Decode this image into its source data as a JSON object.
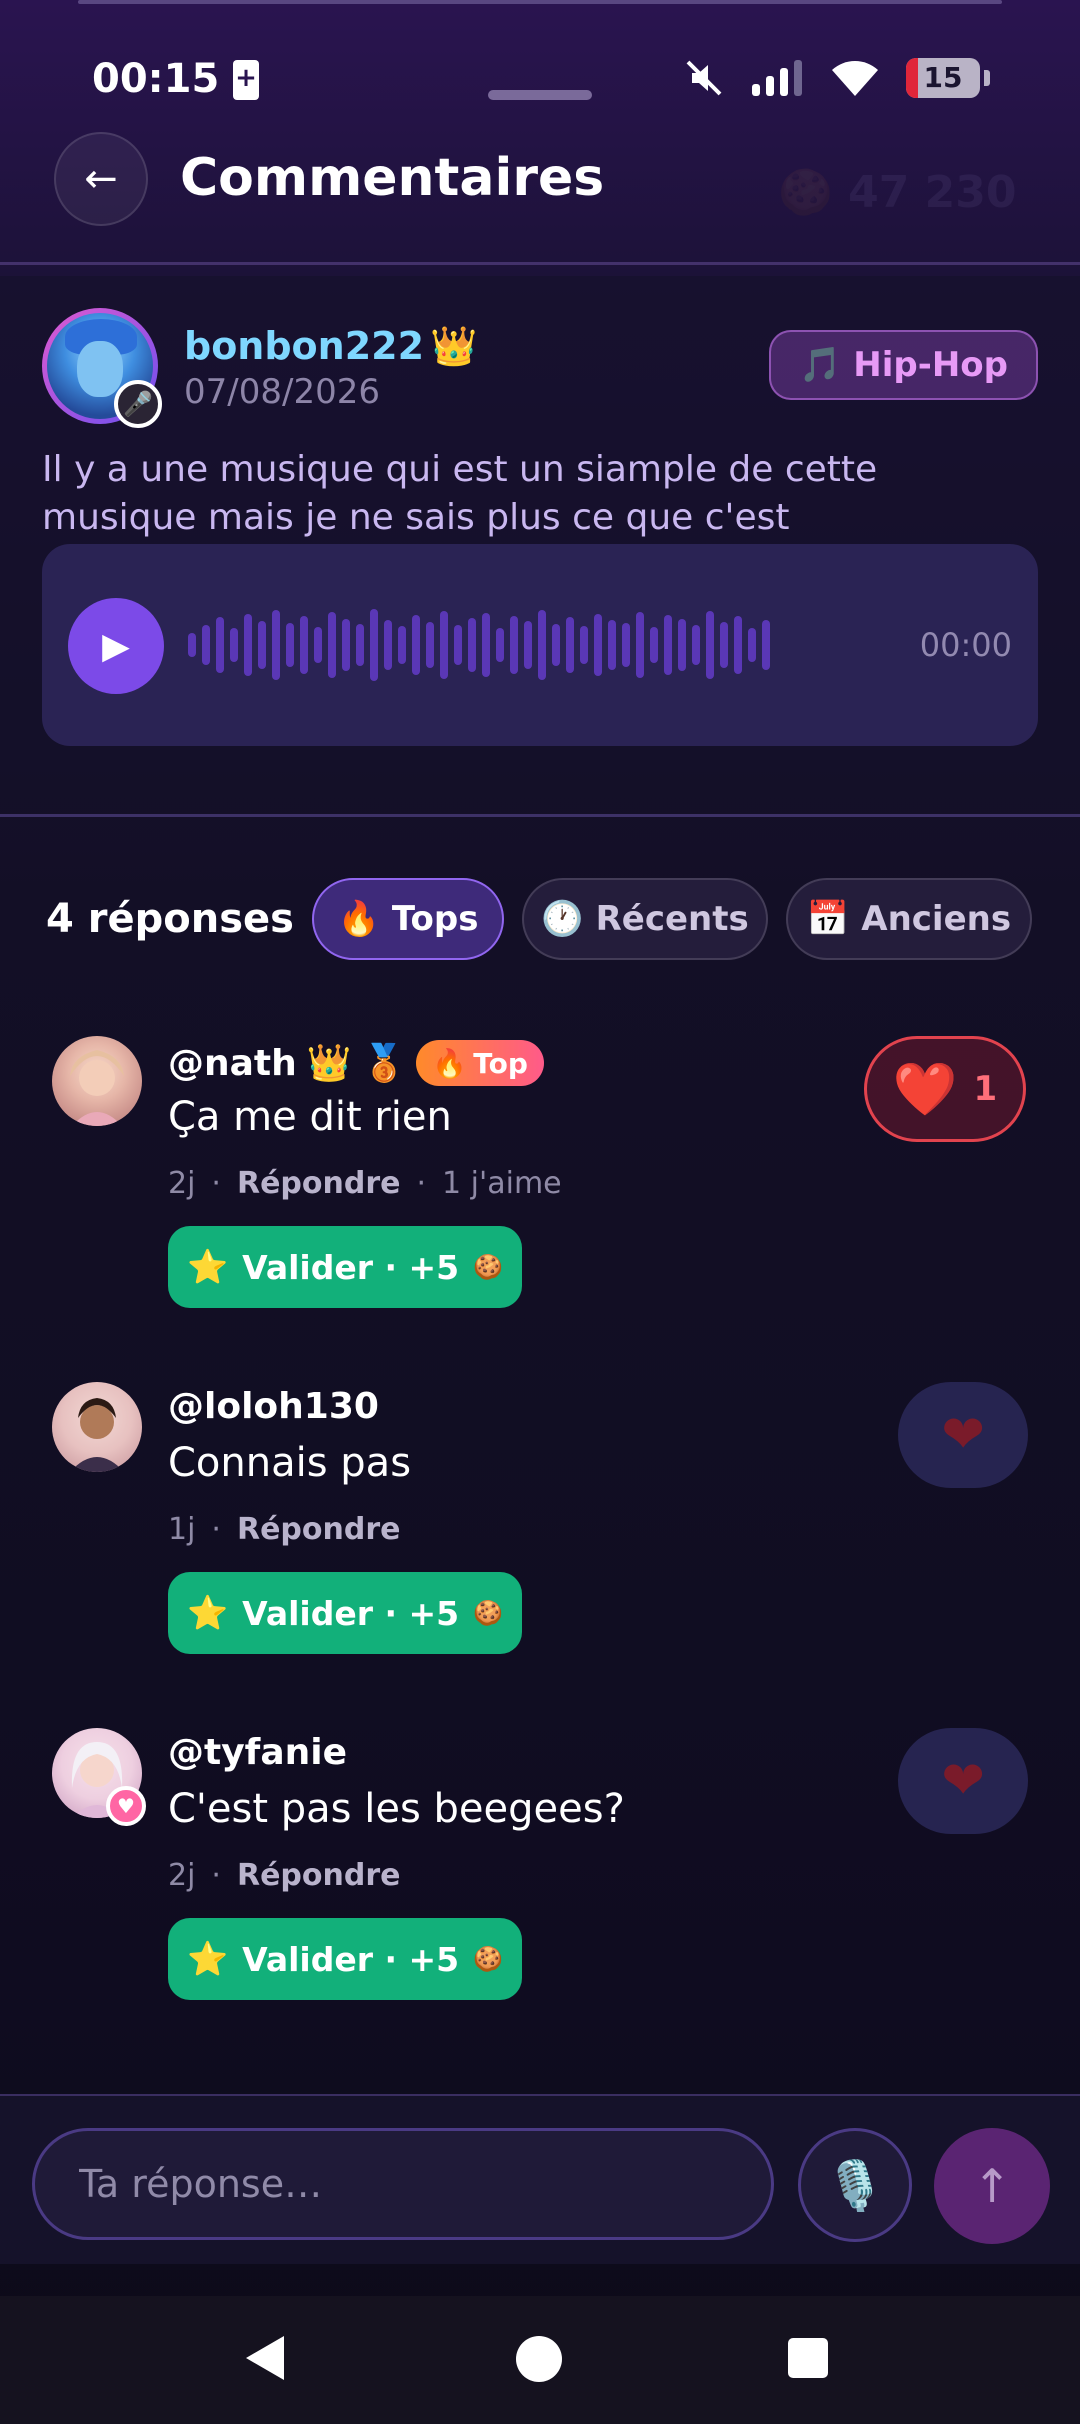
{
  "status_bar": {
    "time": "00:15",
    "battery_level": "15"
  },
  "header": {
    "back_label": "←",
    "title": "Commentaires"
  },
  "post": {
    "username": "bonbon222",
    "crown": "👑",
    "date": "07/08/2026",
    "genre_icon": "🎵",
    "genre": "Hip-Hop",
    "text": "Il y a une musique qui est un siample de cette musique mais je ne sais plus ce que c'est",
    "audio": {
      "play_icon": "▶",
      "duration": "00:00"
    }
  },
  "replies": {
    "count_label": "4 réponses",
    "sort_options": [
      {
        "icon": "🔥",
        "label": "Tops",
        "active": true
      },
      {
        "icon": "🕐",
        "label": "Récents",
        "active": false
      },
      {
        "icon": "📅",
        "label": "Anciens",
        "active": false
      }
    ],
    "items": [
      {
        "handle": "@nath",
        "crown": "👑",
        "medal": "🥉",
        "top_badge": "Top",
        "top_badge_icon": "🔥",
        "text": "Ça me dit rien",
        "age": "2j",
        "reply_label": "Répondre",
        "likes_text": "1 j'aime",
        "validate_label": "Valider · +5",
        "validate_star": "⭐",
        "validate_coin": "🍪",
        "like_heart": "❤️",
        "like_count": "1",
        "liked": true
      },
      {
        "handle": "@loloh130",
        "text": "Connais pas",
        "age": "1j",
        "reply_label": "Répondre",
        "validate_label": "Valider · +5",
        "validate_star": "⭐",
        "validate_coin": "🍪",
        "like_heart": "❤",
        "liked": false
      },
      {
        "handle": "@tyfanie",
        "text": "C'est pas les beegees?",
        "age": "2j",
        "reply_label": "Répondre",
        "validate_label": "Valider · +5",
        "validate_star": "⭐",
        "validate_coin": "🍪",
        "like_heart": "❤",
        "liked": false
      }
    ]
  },
  "composer": {
    "placeholder": "Ta réponse…",
    "mic_icon": "🎙️",
    "send_icon": "↑"
  },
  "colors": {
    "accent": "#7c4ae8",
    "validate": "#12b07a",
    "username": "#7fd7ff",
    "like": "#e2434e"
  }
}
